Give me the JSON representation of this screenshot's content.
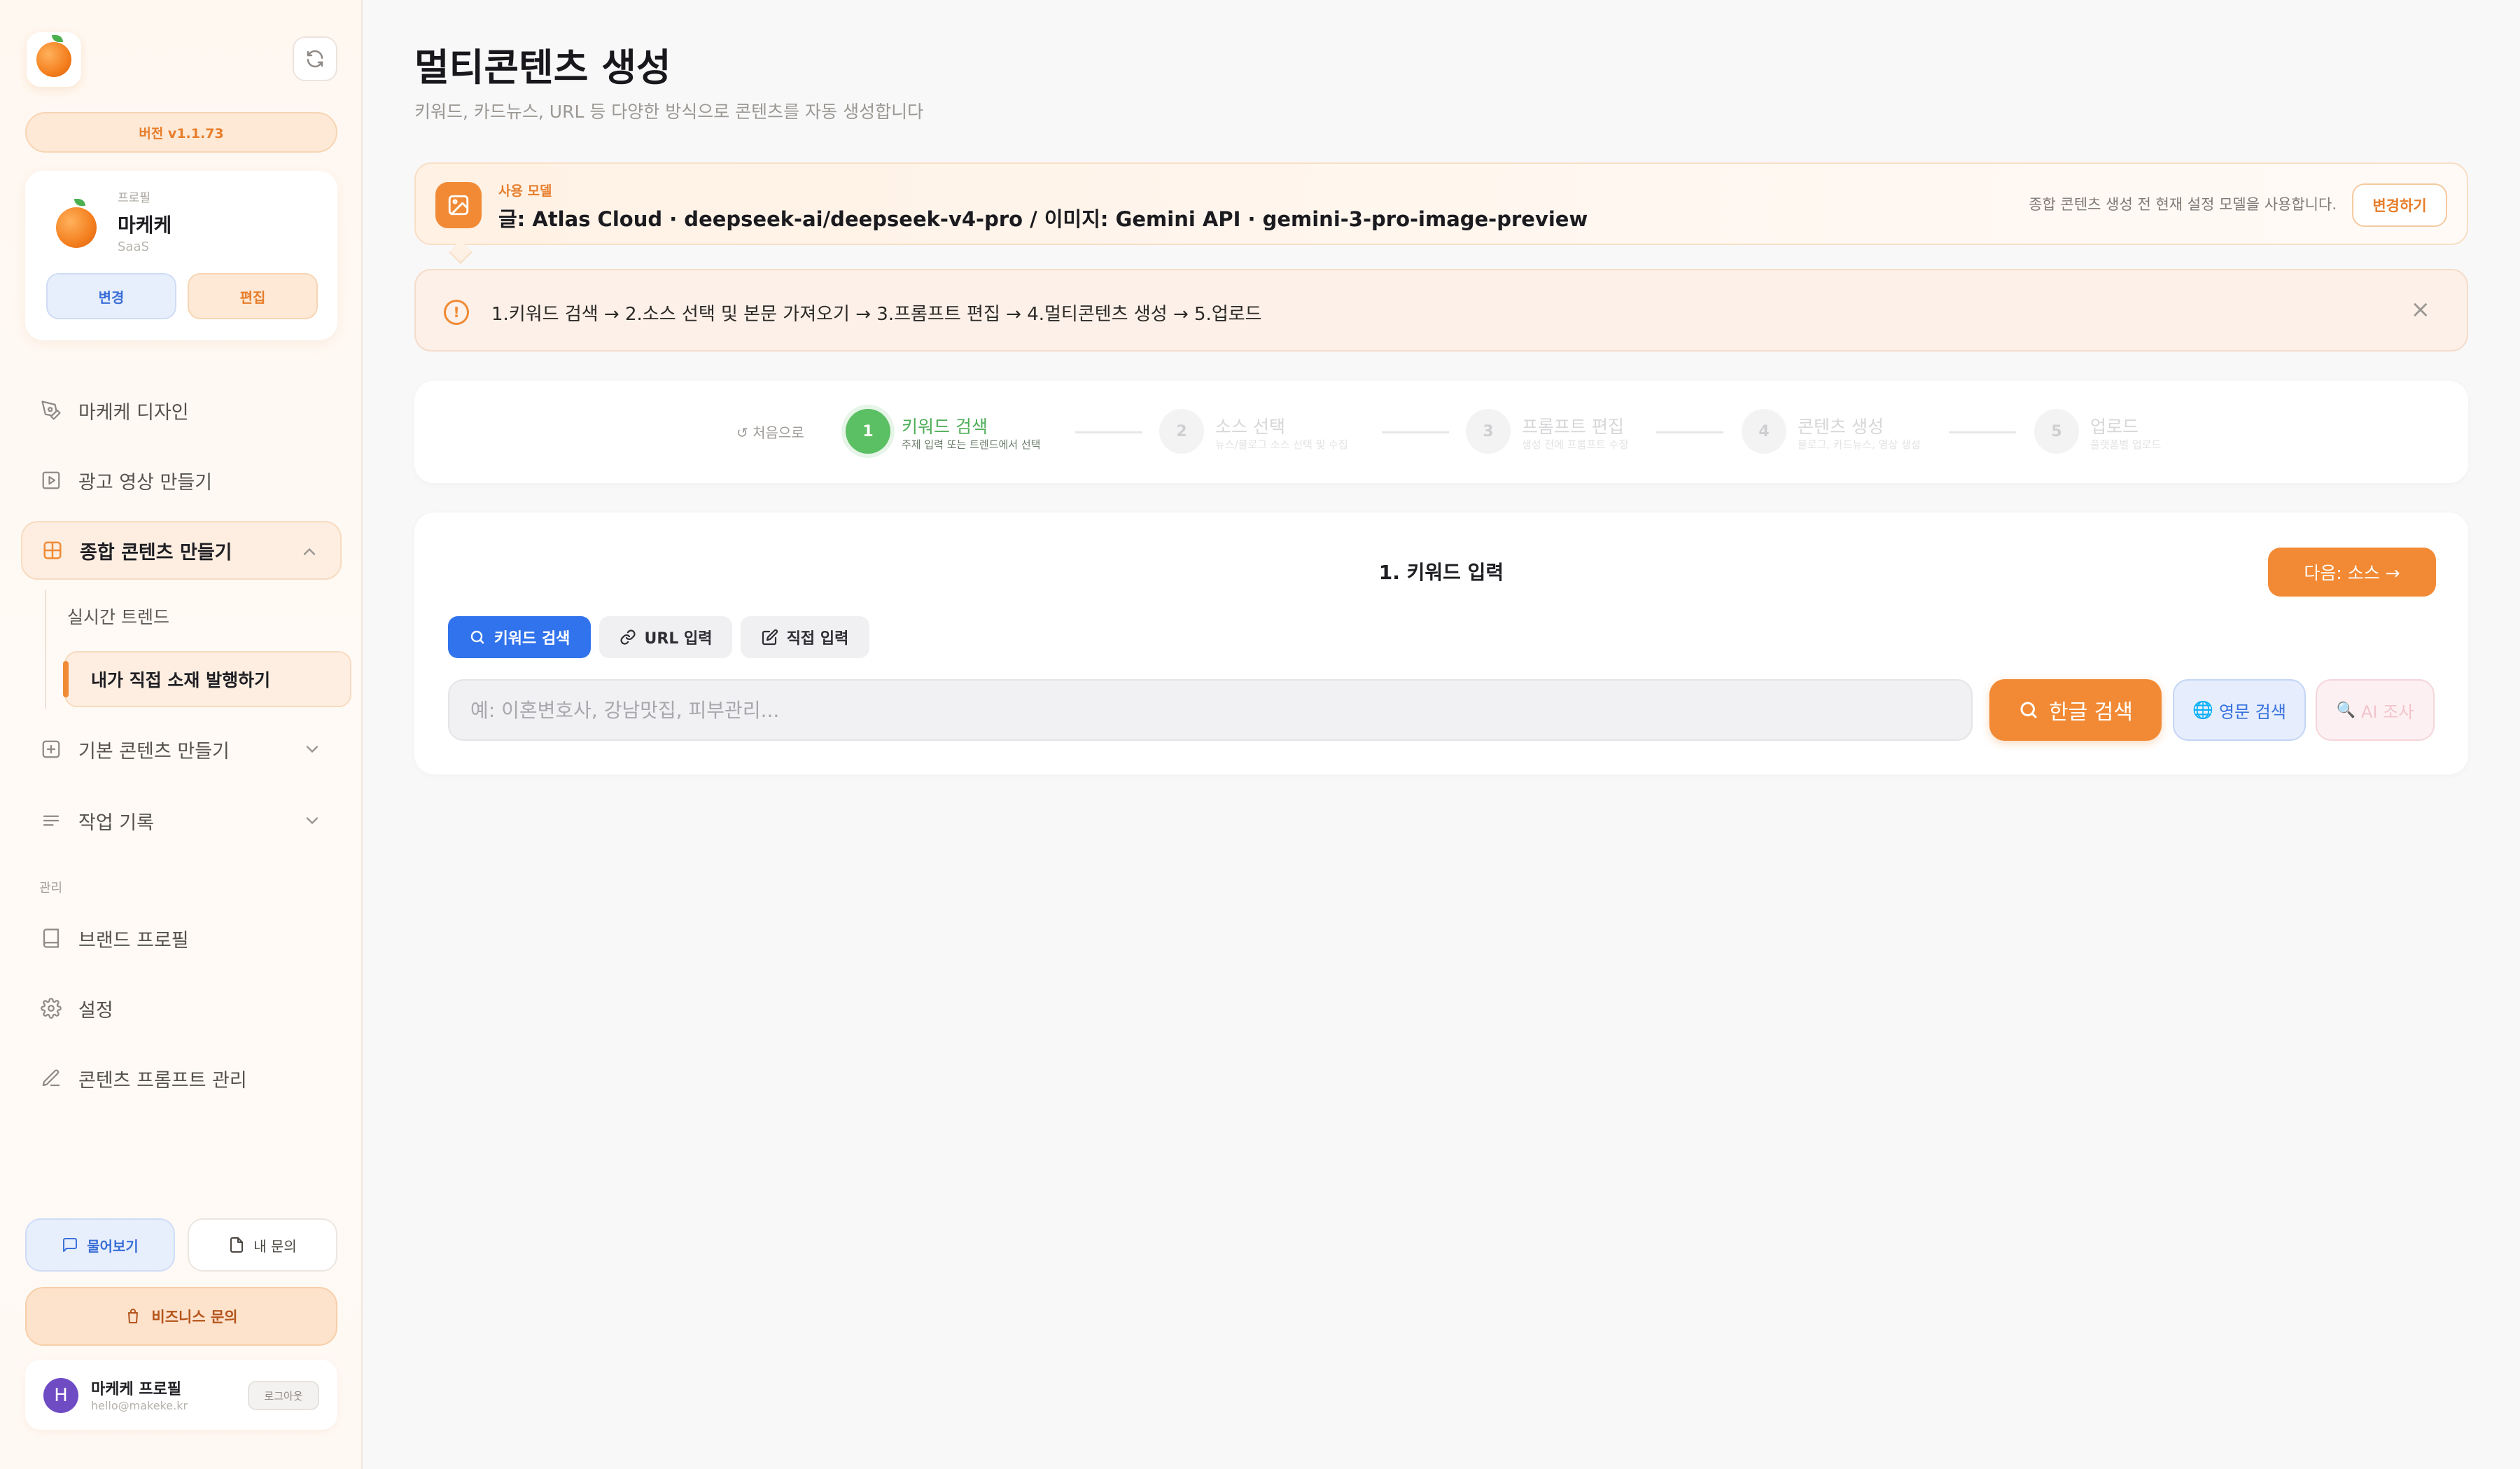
{
  "sidebar": {
    "version": "버전 v1.1.73",
    "profile": {
      "tag": "프로필",
      "name": "마케케",
      "sub": "SaaS",
      "change_label": "변경",
      "edit_label": "편집"
    },
    "nav": {
      "design": "마케케 디자인",
      "ad_video": "광고 영상 만들기",
      "multi_content": "종합 콘텐츠 만들기",
      "sub_trend": "실시간 트렌드",
      "sub_direct": "내가 직접 소재 발행하기",
      "basic_content": "기본 콘텐츠 만들기",
      "history": "작업 기록",
      "section_manage": "관리",
      "brand_profile": "브랜드 프로필",
      "settings": "설정",
      "prompt_manage": "콘텐츠 프롬프트 관리"
    },
    "ask_label": "물어보기",
    "my_question_label": "내 문의",
    "business_label": "비즈니스 문의",
    "user": {
      "avatar_letter": "H",
      "name": "마케케 프로필",
      "email": "hello@makeke.kr",
      "logout_label": "로그아웃"
    }
  },
  "main": {
    "title": "멀티콘텐츠 생성",
    "subtitle": "키워드, 카드뉴스, URL 등 다양한 방식으로 콘텐츠를 자동 생성합니다",
    "model": {
      "label": "사용 모델",
      "value": "글: Atlas Cloud · deepseek-ai/deepseek-v4-pro / 이미지: Gemini API · gemini-3-pro-image-preview",
      "note": "종합 콘텐츠 생성 전 현재 설정 모델을 사용합니다.",
      "change_label": "변경하기"
    },
    "info": {
      "text": "1.키워드 검색 → 2.소스 선택 및 본문 가져오기 → 3.프롬프트 편집 → 4.멀티콘텐츠 생성 → 5.업로드",
      "close": "×"
    },
    "stepper": {
      "restart": "↺ 처음으로",
      "steps": [
        {
          "num": "1",
          "title": "키워드 검색",
          "desc": "주제 입력 또는 트렌드에서 선택"
        },
        {
          "num": "2",
          "title": "소스 선택",
          "desc": "뉴스/블로그 소스 선택 및 수집"
        },
        {
          "num": "3",
          "title": "프롬프트 편집",
          "desc": "생성 전에 프롬프트 수정"
        },
        {
          "num": "4",
          "title": "콘텐츠 생성",
          "desc": "블로그, 카드뉴스, 영상 생성"
        },
        {
          "num": "5",
          "title": "업로드",
          "desc": "플랫폼별 업로드"
        }
      ]
    },
    "input": {
      "title": "1. 키워드 입력",
      "next_label": "다음: 소스 →",
      "tabs": [
        "키워드 검색",
        "URL 입력",
        "직접 입력"
      ],
      "search_placeholder": "예: 이혼변호사, 강남맛집, 피부관리...",
      "search_value": "",
      "kr_search_label": "한글 검색",
      "en_search_label": "영문 검색",
      "ai_search_label": "AI 조사"
    }
  },
  "colors": {
    "accent": "#f28a35",
    "primary_blue": "#3173ec",
    "step_active": "#5bbf63"
  }
}
